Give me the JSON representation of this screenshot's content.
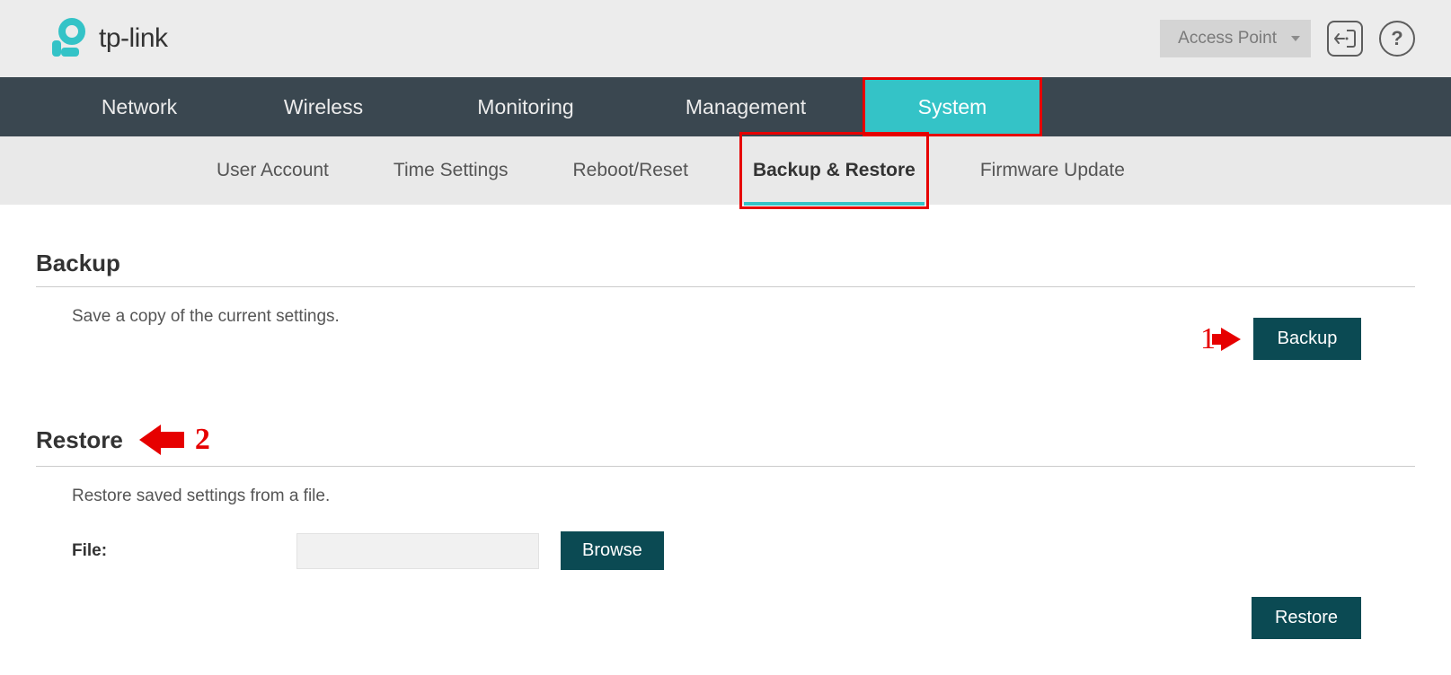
{
  "header": {
    "brand": "tp-link",
    "mode_dropdown": "Access Point"
  },
  "mainnav": {
    "items": [
      "Network",
      "Wireless",
      "Monitoring",
      "Management",
      "System"
    ],
    "active_index": 4
  },
  "subnav": {
    "items": [
      "User Account",
      "Time Settings",
      "Reboot/Reset",
      "Backup & Restore",
      "Firmware Update"
    ],
    "active_index": 3
  },
  "backup": {
    "title": "Backup",
    "desc": "Save a copy of the current settings.",
    "button": "Backup"
  },
  "restore": {
    "title": "Restore",
    "desc": "Restore saved settings from a file.",
    "file_label": "File:",
    "browse": "Browse",
    "button": "Restore"
  },
  "annotations": {
    "one": "1",
    "two": "2"
  }
}
